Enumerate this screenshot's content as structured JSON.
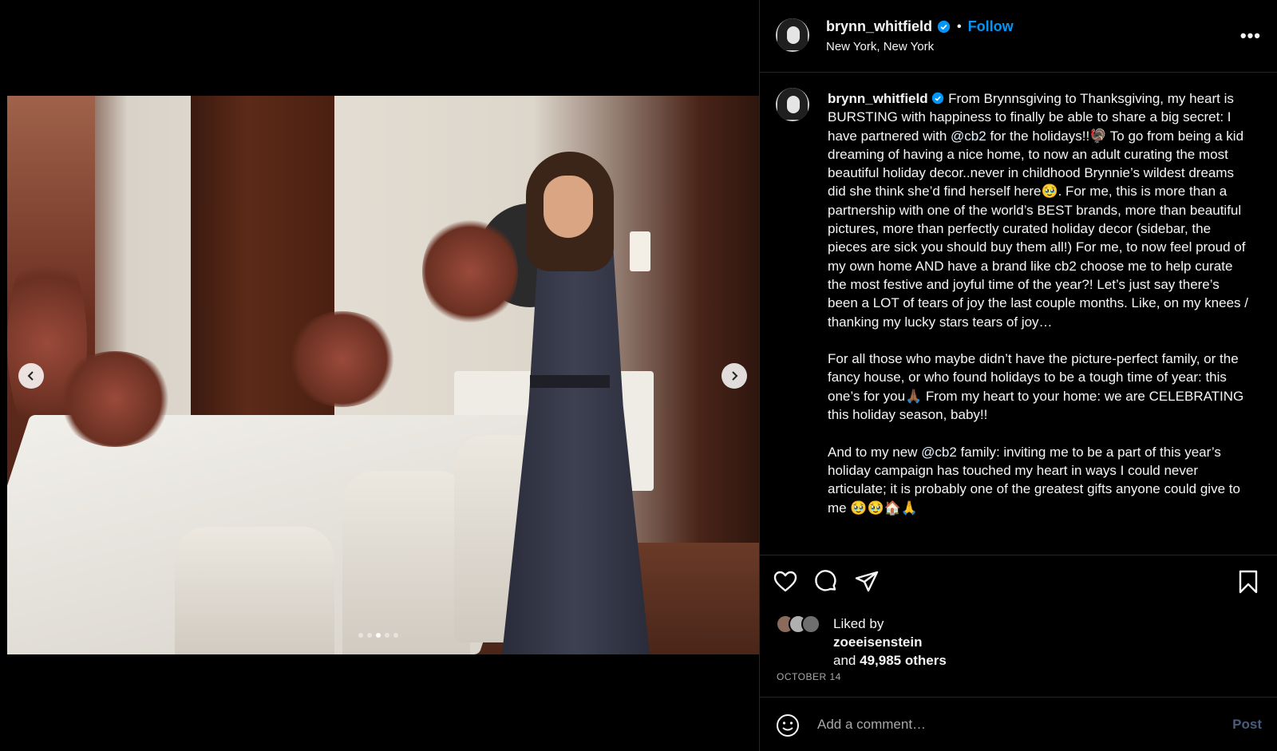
{
  "post": {
    "username": "brynn_whitfield",
    "follow_label": "Follow",
    "location": "New York, New York",
    "more_label": "•••",
    "caption_parts": {
      "p1": "From Brynnsgiving to Thanksgiving, my heart is BURSTING with happiness to finally be able to share a big secret: I have partnered with ",
      "mention1": "@cb2",
      "p2": " for the holidays!!🦃 To go from being a kid dreaming of having a nice home, to now an adult curating the most beautiful holiday decor..never in childhood Brynnie’s wildest dreams did she think she’d find herself here🥹. For me, this is more than a partnership with one of the world’s BEST brands, more than beautiful pictures, more than perfectly curated holiday decor (sidebar, the pieces are sick you should buy them all!) For me, to now feel proud of my own home AND have a brand like cb2 choose me to help curate the most festive and joyful time of the year?! Let’s just say there’s been a LOT of tears of joy the last couple months. Like, on my knees / thanking my lucky stars tears of joy…\n\nFor all those who maybe didn’t have the picture-perfect family, or the fancy house, or who found holidays to be a tough time of year: this one’s for you🙏🏾 From my heart to your home: we are CELEBRATING this holiday season, baby!!\n\nAnd to my new ",
      "mention2": "@cb2",
      "p3": " family: inviting me to be a part of this year’s holiday campaign has touched my heart in ways I could never articulate; it is probably one of the greatest gifts anyone could give to me 🥹🥹🏠🙏"
    },
    "liked_by_label": "Liked by",
    "liked_by_user": "zoeeisenstein",
    "and_label": "and",
    "others_count": "49,985 others",
    "date": "OCTOBER 14",
    "carousel": {
      "total_slides": 5,
      "active_slide": 3
    }
  },
  "comment": {
    "placeholder": "Add a comment…",
    "post_label": "Post"
  },
  "icons": {
    "verified": "verified-badge-icon",
    "like": "heart-icon",
    "comment": "comment-icon",
    "share": "send-icon",
    "save": "bookmark-icon",
    "emoji": "emoji-icon",
    "prev": "chevron-left-icon",
    "next": "chevron-right-icon"
  },
  "colors": {
    "accent": "#0095f6",
    "background": "#000000",
    "text": "#f5f5f5",
    "muted": "#a8a8a8"
  }
}
